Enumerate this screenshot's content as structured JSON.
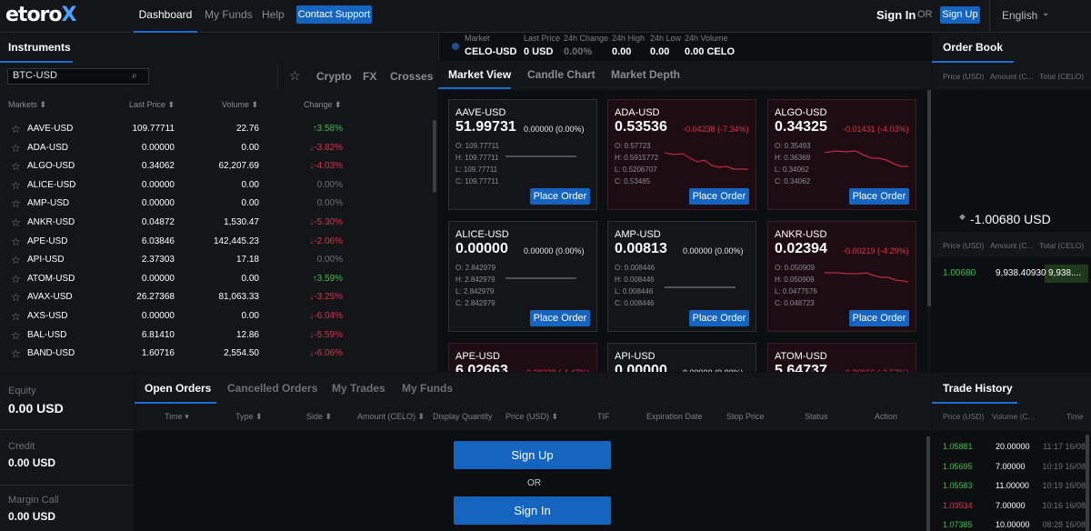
{
  "nav": {
    "logo_main": "etoro",
    "logo_x": "X",
    "items": [
      "Dashboard",
      "My Funds",
      "Help"
    ],
    "support": "Contact Support",
    "sign_in": "Sign In",
    "or": "OR",
    "sign_up": "Sign Up",
    "language": "English"
  },
  "instruments": {
    "title": "Instruments",
    "search_value": "BTC-USD",
    "categories": [
      "Crypto",
      "FX",
      "Crosses"
    ],
    "headers": {
      "market": "Markets",
      "last_price": "Last Price",
      "volume": "Volume",
      "change": "Change"
    },
    "rows": [
      {
        "sym": "AAVE-USD",
        "price": "109.77711",
        "vol": "22.76",
        "chg": "3.58%",
        "dir": "up"
      },
      {
        "sym": "ADA-USD",
        "price": "0.00000",
        "vol": "0.00",
        "chg": "-3.82%",
        "dir": "down"
      },
      {
        "sym": "ALGO-USD",
        "price": "0.34062",
        "vol": "62,207.69",
        "chg": "-4.03%",
        "dir": "down"
      },
      {
        "sym": "ALICE-USD",
        "price": "0.00000",
        "vol": "0.00",
        "chg": "0.00%",
        "dir": "zero"
      },
      {
        "sym": "AMP-USD",
        "price": "0.00000",
        "vol": "0.00",
        "chg": "0.00%",
        "dir": "zero"
      },
      {
        "sym": "ANKR-USD",
        "price": "0.04872",
        "vol": "1,530.47",
        "chg": "-5.30%",
        "dir": "down"
      },
      {
        "sym": "APE-USD",
        "price": "6.03846",
        "vol": "142,445.23",
        "chg": "-2.06%",
        "dir": "down"
      },
      {
        "sym": "API-USD",
        "price": "2.37303",
        "vol": "17.18",
        "chg": "0.00%",
        "dir": "zero"
      },
      {
        "sym": "ATOM-USD",
        "price": "0.00000",
        "vol": "0.00",
        "chg": "3.59%",
        "dir": "up"
      },
      {
        "sym": "AVAX-USD",
        "price": "26.27368",
        "vol": "81,063.33",
        "chg": "-3.25%",
        "dir": "down"
      },
      {
        "sym": "AXS-USD",
        "price": "0.00000",
        "vol": "0.00",
        "chg": "-6.04%",
        "dir": "down"
      },
      {
        "sym": "BAL-USD",
        "price": "6.81410",
        "vol": "12.86",
        "chg": "-5.59%",
        "dir": "down"
      },
      {
        "sym": "BAND-USD",
        "price": "1.60716",
        "vol": "2,554.50",
        "chg": "-6.06%",
        "dir": "down"
      }
    ]
  },
  "ticker": {
    "labels": [
      "Market",
      "Last Price",
      "24h Change",
      "24h High",
      "24h Low",
      "24h Volume"
    ],
    "values": [
      "CELO-USD",
      "0 USD",
      "0.00%",
      "0.00",
      "0.00",
      "0.00 CELO"
    ]
  },
  "market_view": {
    "tabs": [
      "Market View",
      "Candle Chart",
      "Market Depth"
    ],
    "button": "Place Order",
    "tiles": [
      {
        "sym": "AAVE-USD",
        "price": "51.99731",
        "chg": "0.00000 (0.00%)",
        "neg": false,
        "o": "O: 109.77711",
        "h": "H: 109.77711",
        "l": "L: 109.77711",
        "c": "C: 109.77711"
      },
      {
        "sym": "ADA-USD",
        "price": "0.53536",
        "chg": "-0.04238 (-7.34%)",
        "neg": true,
        "o": "O: 0.57723",
        "h": "H: 0.5915772",
        "l": "L: 0.5206707",
        "c": "C: 0.53485"
      },
      {
        "sym": "ALGO-USD",
        "price": "0.34325",
        "chg": "-0.01431 (-4.03%)",
        "neg": true,
        "o": "O: 0.35493",
        "h": "H: 0.36369",
        "l": "L: 0.34062",
        "c": "C: 0.34062"
      },
      {
        "sym": "ALICE-USD",
        "price": "0.00000",
        "chg": "0.00000 (0.00%)",
        "neg": false,
        "o": "O: 2.842979",
        "h": "H: 2.842979",
        "l": "L: 2.842979",
        "c": "C: 2.842979"
      },
      {
        "sym": "AMP-USD",
        "price": "0.00813",
        "chg": "0.00000 (0.00%)",
        "neg": false,
        "o": "O: 0.008446",
        "h": "H: 0.008446",
        "l": "L: 0.008446",
        "c": "C: 0.008446"
      },
      {
        "sym": "ANKR-USD",
        "price": "0.02394",
        "chg": "-0.00219 (-4.29%)",
        "neg": true,
        "o": "O: 0.050909",
        "h": "H: 0.050909",
        "l": "L: 0.0477576",
        "c": "C: 0.048723"
      },
      {
        "sym": "APE-USD",
        "price": "6.02663",
        "chg": "-0.28238 (-4.47%)",
        "neg": true
      },
      {
        "sym": "API-USD",
        "price": "0.00000",
        "chg": "0.00000 (0.00%)",
        "neg": false
      },
      {
        "sym": "ATOM-USD",
        "price": "5.64737",
        "chg": "-0.30566 (-2.57%)",
        "neg": true
      }
    ]
  },
  "order_book": {
    "title": "Order Book",
    "headers": [
      "Price (USD)",
      "Amount (C...",
      "Total (CELO)"
    ],
    "headers2": [
      "Price (USD)",
      "Amount (C...",
      "Total (CELO)"
    ],
    "mid_price": "-1.00680 USD",
    "row": {
      "price": "1.00680",
      "amount": "9,938.40930",
      "total": "9,938...."
    }
  },
  "account": {
    "equity_label": "Equity",
    "equity": "0.00 USD",
    "credit_label": "Credit",
    "credit": "0.00 USD",
    "margin_label": "Margin Call",
    "margin": "0.00 USD"
  },
  "orders": {
    "tabs": [
      "Open Orders",
      "Cancelled Orders",
      "My Trades",
      "My Funds"
    ],
    "columns": [
      "Time",
      "Type",
      "Side",
      "Amount (CELO)",
      "Display Quantity",
      "Price (USD)",
      "TIF",
      "Expiration Date",
      "Stop Price",
      "Status",
      "Action"
    ],
    "sign_up": "Sign Up",
    "or": "OR",
    "sign_in": "Sign In"
  },
  "trade_history": {
    "title": "Trade History",
    "headers": [
      "Price (USD)",
      "Volume (C...",
      "Time"
    ],
    "rows": [
      {
        "p": "1.05881",
        "v": "20.00000",
        "t": "11:17 16/08",
        "dir": "up"
      },
      {
        "p": "1.05695",
        "v": "7.00000",
        "t": "10:19 16/08",
        "dir": "up"
      },
      {
        "p": "1.05583",
        "v": "11.00000",
        "t": "10:19 16/08",
        "dir": "up"
      },
      {
        "p": "1.03534",
        "v": "7.00000",
        "t": "10:16 16/08",
        "dir": "down"
      },
      {
        "p": "1.07385",
        "v": "10.00000",
        "t": "08:28 16/08",
        "dir": "up"
      }
    ]
  },
  "colors": {
    "accent": "#1565c0",
    "up": "#36c24a",
    "down": "#e0304a"
  }
}
